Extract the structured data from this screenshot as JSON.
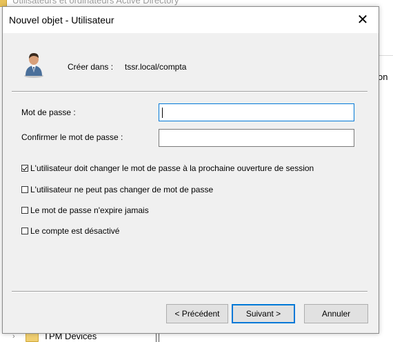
{
  "background": {
    "window_title": "Utilisateurs et ordinateurs Active Directory",
    "right_column_fragment": "on",
    "tree_item": "TPM Devices"
  },
  "dialog": {
    "title": "Nouvel objet - Utilisateur",
    "close_glyph": "✕",
    "create_in_label": "Créer dans :",
    "create_in_value": "tssr.local/compta",
    "password_label": "Mot de passe :",
    "password_value": "",
    "confirm_label": "Confirmer le mot de passe :",
    "confirm_value": "",
    "options": [
      {
        "label": "L'utilisateur doit changer le mot de passe à la prochaine ouverture de session",
        "checked": true
      },
      {
        "label": "L'utilisateur ne peut pas changer de mot de passe",
        "checked": false
      },
      {
        "label": "Le mot de passe n'expire jamais",
        "checked": false
      },
      {
        "label": "Le compte est désactivé",
        "checked": false
      }
    ],
    "buttons": {
      "back": "< Précédent",
      "next": "Suivant >",
      "cancel": "Annuler"
    }
  }
}
